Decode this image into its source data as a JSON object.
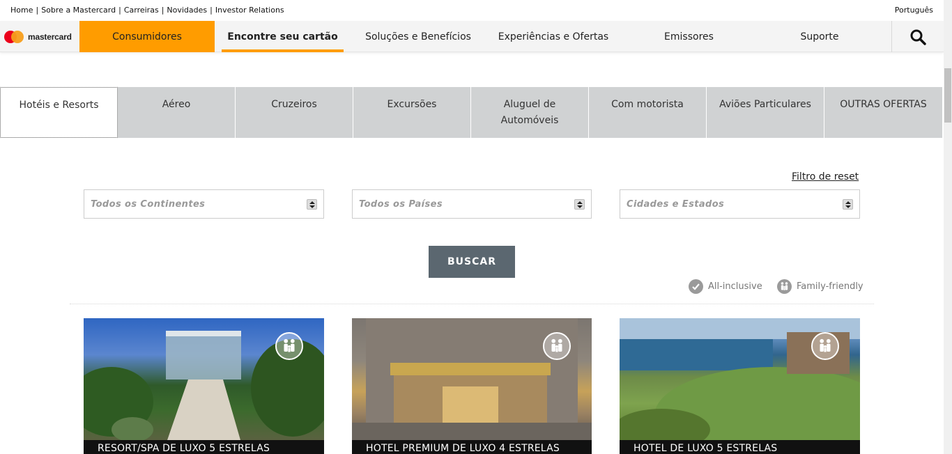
{
  "utility": {
    "links": [
      "Home",
      "Sobre a Mastercard",
      "Carreiras",
      "Novidades",
      "Investor Relations"
    ],
    "language": "Português"
  },
  "brand": {
    "name": "mastercard"
  },
  "nav": {
    "consumers": "Consumidores",
    "find_card": "Encontre seu cartão",
    "solutions": "Soluções e Benefícios",
    "experiences": "Experiências e Ofertas",
    "issuers": "Emissores",
    "support": "Suporte"
  },
  "tabs": [
    {
      "label": "Hotéis e Resorts"
    },
    {
      "label": "Aéreo"
    },
    {
      "label": "Cruzeiros"
    },
    {
      "label": "Excursões"
    },
    {
      "label": "Aluguel de Automóveis"
    },
    {
      "label": "Com motorista"
    },
    {
      "label": "Aviões Particulares"
    },
    {
      "label": "OUTRAS OFERTAS"
    }
  ],
  "filters": {
    "reset": "Filtro de reset",
    "continents_placeholder": "Todos os Continentes",
    "countries_placeholder": "Todos os Países",
    "cities_placeholder": "Cidades e Estados",
    "search_button": "BUSCAR"
  },
  "legend": {
    "all_inclusive": "All-inclusive",
    "family_friendly": "Family-friendly"
  },
  "hotels": [
    {
      "caption": "RESORT/SPA DE LUXO 5 ESTRELAS"
    },
    {
      "caption": "HOTEL PREMIUM DE LUXO 4 ESTRELAS"
    },
    {
      "caption": "HOTEL DE LUXO 5 ESTRELAS"
    }
  ],
  "colors": {
    "accent": "#ff9c00",
    "tab_bg": "#d0d2d3",
    "button_bg": "#5b6770"
  }
}
